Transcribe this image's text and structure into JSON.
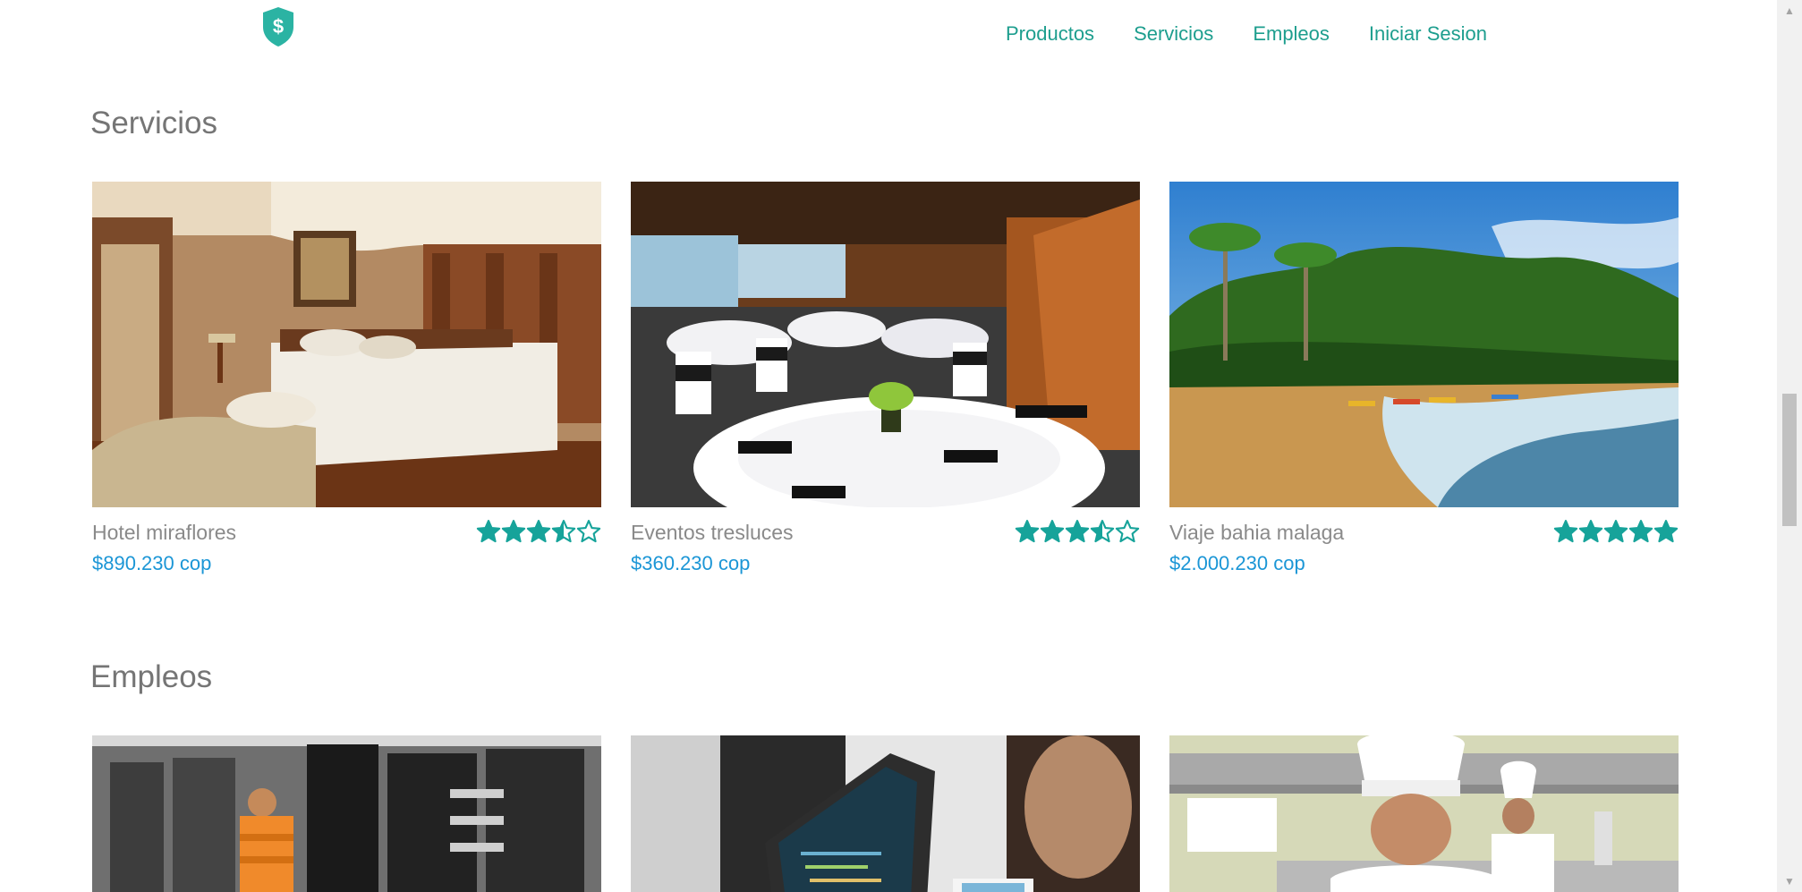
{
  "header": {
    "nav": [
      "Productos",
      "Servicios",
      "Empleos",
      "Iniciar Sesion"
    ]
  },
  "colors": {
    "accent": "#1d9e8e",
    "price": "#1b96d6",
    "star": "#16a39a",
    "heading": "#757575"
  },
  "servicios": {
    "title": "Servicios",
    "items": [
      {
        "name": "Hotel miraflores",
        "price": "$890.230 cop",
        "rating": 3.5
      },
      {
        "name": "Eventos tresluces",
        "price": "$360.230 cop",
        "rating": 3.5
      },
      {
        "name": "Viaje bahia malaga",
        "price": "$2.000.230 cop",
        "rating": 5
      }
    ]
  },
  "empleos": {
    "title": "Empleos"
  }
}
